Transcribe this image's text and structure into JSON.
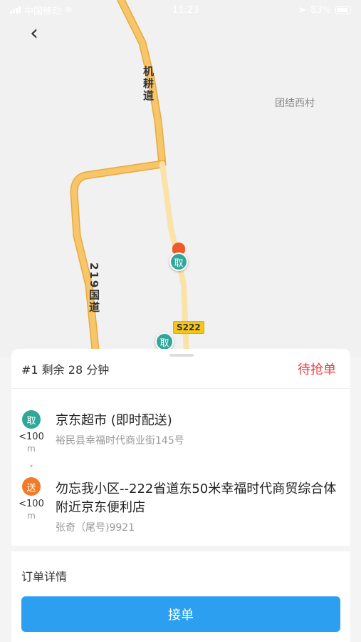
{
  "status_bar": {
    "carrier": "中国移动",
    "time": "11:23",
    "battery": "83%"
  },
  "map": {
    "road_label_1": "机耕道",
    "road_label_2": "219国道",
    "place_label": "团结西村",
    "route_badge": "S222",
    "pin_pickup": "取",
    "pin_pickup_2": "取",
    "colors": {
      "road": "#f7c66a",
      "road_edge": "#e8a93c",
      "minor_road": "#fbe3a8"
    }
  },
  "order": {
    "title": "#1 剩余 28 分钟",
    "status": "待抢单",
    "status_color": "#f03c3c"
  },
  "pickup": {
    "pin": "取",
    "distance": "<100",
    "unit": "m",
    "name": "京东超市 (即时配送)",
    "address": "裕民县幸福时代商业街145号"
  },
  "delivery": {
    "pin": "送",
    "distance": "<100",
    "unit": "m",
    "name": "勿忘我小区--222省道东50米幸福时代商贸综合体附近京东便利店",
    "contact": "张奇（尾号)9921"
  },
  "detail": {
    "label": "订单详情",
    "accept_button": "接单",
    "accept_color": "#2d9ff0"
  }
}
